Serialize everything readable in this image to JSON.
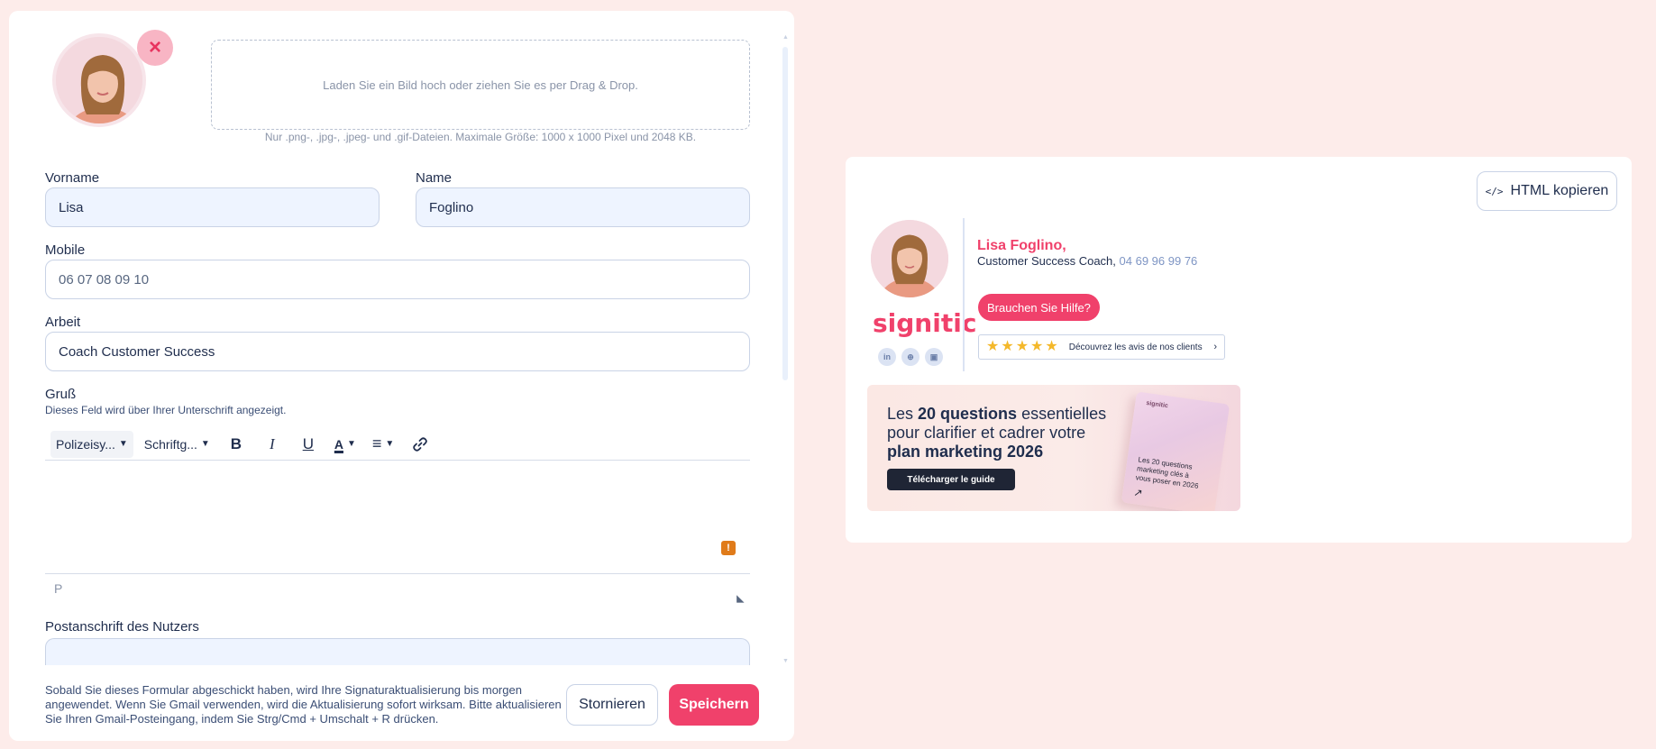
{
  "form": {
    "remove_icon": "×",
    "dropzone_text": "Laden Sie ein Bild hoch oder ziehen Sie es per Drag & Drop.",
    "dropzone_hint": "Nur .png-, .jpg-, .jpeg- und .gif-Dateien. Maximale Größe: 1000 x 1000 Pixel und 2048 KB.",
    "firstname": {
      "label": "Vorname",
      "value": "Lisa"
    },
    "lastname": {
      "label": "Name",
      "value": "Foglino"
    },
    "mobile": {
      "label": "Mobile",
      "value": "06 07 08 09 10"
    },
    "work": {
      "label": "Arbeit",
      "value": "Coach Customer Success"
    },
    "greeting": {
      "label": "Gruß",
      "hint": "Dieses Feld wird über Ihrer Unterschrift angezeigt.",
      "toolbar": {
        "font_family": "Polizeisy...",
        "font_size": "Schriftg...",
        "bold": "B",
        "italic": "I",
        "underline": "U",
        "text_color": "A",
        "line_height": "≡",
        "link": "🔗"
      },
      "warning_badge": "!",
      "path": "P"
    },
    "postal": {
      "label": "Postanschrift des Nutzers",
      "value": ""
    },
    "footer_note": "Sobald Sie dieses Formular abgeschickt haben, wird Ihre Signaturaktualisierung bis morgen angewendet. Wenn Sie Gmail verwenden, wird die Aktualisierung sofort wirksam. Bitte aktualisieren Sie Ihren Gmail-Posteingang, indem Sie Strg/Cmd + Umschalt + R drücken.",
    "cancel_label": "Stornieren",
    "save_label": "Speichern"
  },
  "preview": {
    "copy_label": "HTML kopieren",
    "copy_icon": "</>",
    "logo_text": "signitic",
    "social": [
      "in",
      "⊕",
      "▣"
    ],
    "name": "Lisa Foglino,",
    "title": "Customer Success Coach,",
    "phone": "04 69 96 99 76",
    "help_label": "Brauchen Sie Hilfe?",
    "reviews_text": "Découvrez les avis de nos clients",
    "reviews_arrow": "›",
    "banner": {
      "line1_pre": "Les ",
      "line1_bold": "20 questions",
      "line1_post": " essentielles",
      "line2": "pour clarifier et cadrer votre",
      "line3_bold": "plan marketing 2026",
      "cta": "Télécharger le guide",
      "booklet_brand": "signitic",
      "booklet_title": "Les 20 questions marketing clés à vous poser en 2026",
      "booklet_arrow": "↗"
    }
  },
  "colors": {
    "accent": "#f0416b",
    "background": "#fdecea",
    "text": "#1f2d4d",
    "input_fill": "#eef4ff",
    "star": "#f4b82a"
  }
}
